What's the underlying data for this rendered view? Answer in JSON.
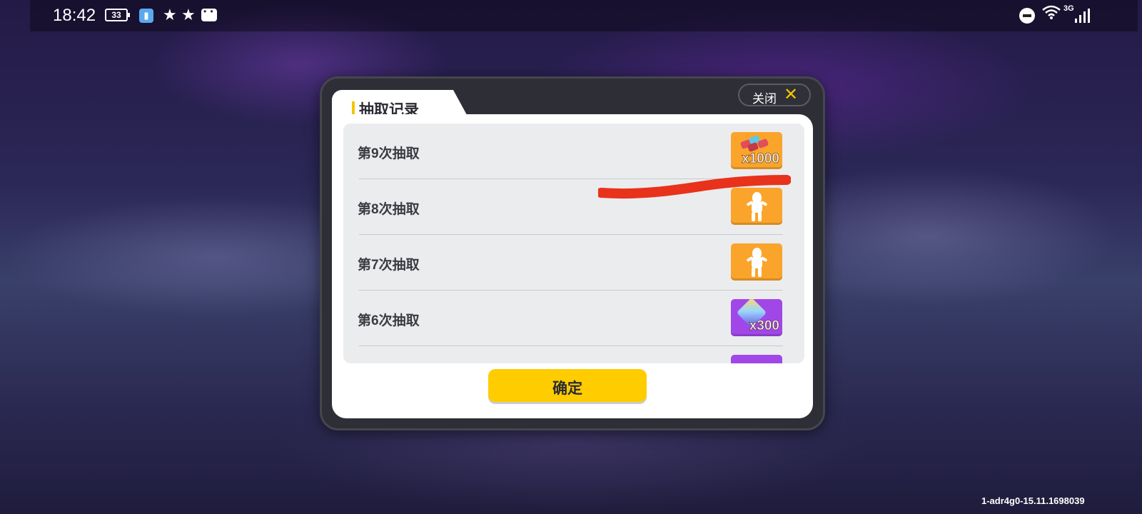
{
  "status_bar": {
    "time": "18:42",
    "battery": "33",
    "icons": [
      "app-shield-icon",
      "star-icon",
      "star-icon",
      "chat-icon",
      "do-not-disturb-icon",
      "wifi-icon",
      "signal-icon"
    ],
    "network": "3G"
  },
  "dialog": {
    "title": "抽取记录",
    "close_label": "关闭",
    "confirm_label": "确定",
    "accent_color": "#ffcc00",
    "records": [
      {
        "label": "第9次抽取",
        "reward_icon": "gems-icon",
        "reward_count": "x1000",
        "rarity_color": "#fba42b"
      },
      {
        "label": "第8次抽取",
        "reward_icon": "character-icon",
        "reward_count": "",
        "rarity_color": "#fba42b"
      },
      {
        "label": "第7次抽取",
        "reward_icon": "character-icon",
        "reward_count": "",
        "rarity_color": "#fba42b"
      },
      {
        "label": "第6次抽取",
        "reward_icon": "crystal-icon",
        "reward_count": "x300",
        "rarity_color": "#a147e8"
      }
    ]
  },
  "version": "1-adr4g0-15.11.1698039"
}
